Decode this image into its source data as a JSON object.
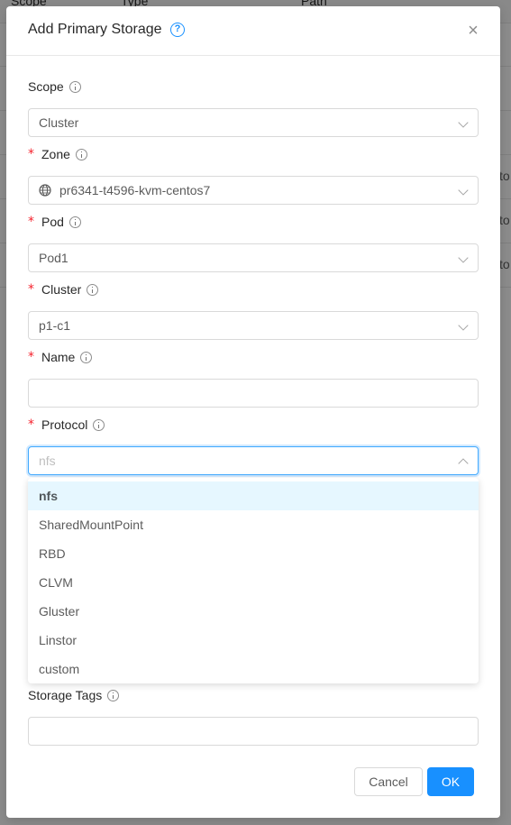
{
  "background": {
    "headers": [
      "Scope",
      "Type",
      "Path"
    ],
    "cells": [
      "to",
      "to",
      "to"
    ]
  },
  "modal": {
    "title": "Add Primary Storage",
    "fields": {
      "scope": {
        "label": "Scope",
        "value": "Cluster"
      },
      "zone": {
        "label": "Zone",
        "value": "pr6341-t4596-kvm-centos7"
      },
      "pod": {
        "label": "Pod",
        "value": "Pod1"
      },
      "cluster": {
        "label": "Cluster",
        "value": "p1-c1"
      },
      "name": {
        "label": "Name",
        "value": ""
      },
      "protocol": {
        "label": "Protocol",
        "placeholder": "nfs"
      },
      "storage_tags": {
        "label": "Storage Tags",
        "value": ""
      }
    },
    "protocol_options": [
      "nfs",
      "SharedMountPoint",
      "RBD",
      "CLVM",
      "Gluster",
      "Linstor",
      "custom"
    ],
    "required_mark": "*",
    "buttons": {
      "cancel": "Cancel",
      "ok": "OK"
    }
  },
  "colors": {
    "primary": "#1890ff",
    "required": "#f5222d",
    "active_option_bg": "#e6f7ff"
  },
  "icons": {
    "help": "question-circle-icon",
    "close": "close-icon",
    "info": "info-circle-icon",
    "globe": "globe-icon"
  }
}
